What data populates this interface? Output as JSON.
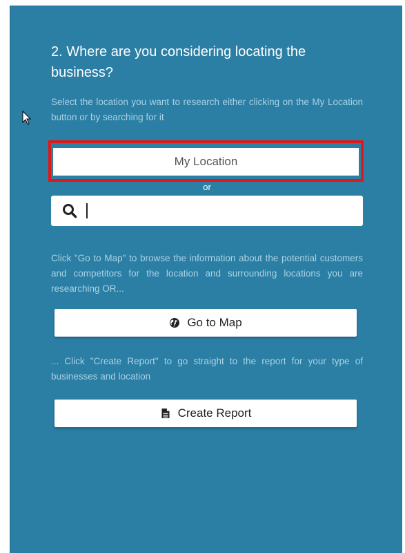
{
  "heading": "2. Where are you considering locating the business?",
  "intro_text": "Select the location you want to research either clicking on the My Location button or by searching for it",
  "my_location_label": "My Location",
  "or_label": "or",
  "search": {
    "value": "",
    "placeholder": "",
    "icon": "search-icon"
  },
  "map_text": "Click \"Go to Map\" to browse the information about the potential customers and competitors for the location and surrounding locations you are researching OR...",
  "go_to_map": {
    "label": "Go to Map",
    "icon": "globe-icon"
  },
  "report_text": "... Click \"Create Report\" to go straight to the report for your type of businesses and location",
  "create_report": {
    "label": "Create Report",
    "icon": "document-icon"
  },
  "colors": {
    "panel_background": "#2b7ea4",
    "highlight_border": "#e01818",
    "description_text": "#a9d3e5"
  }
}
